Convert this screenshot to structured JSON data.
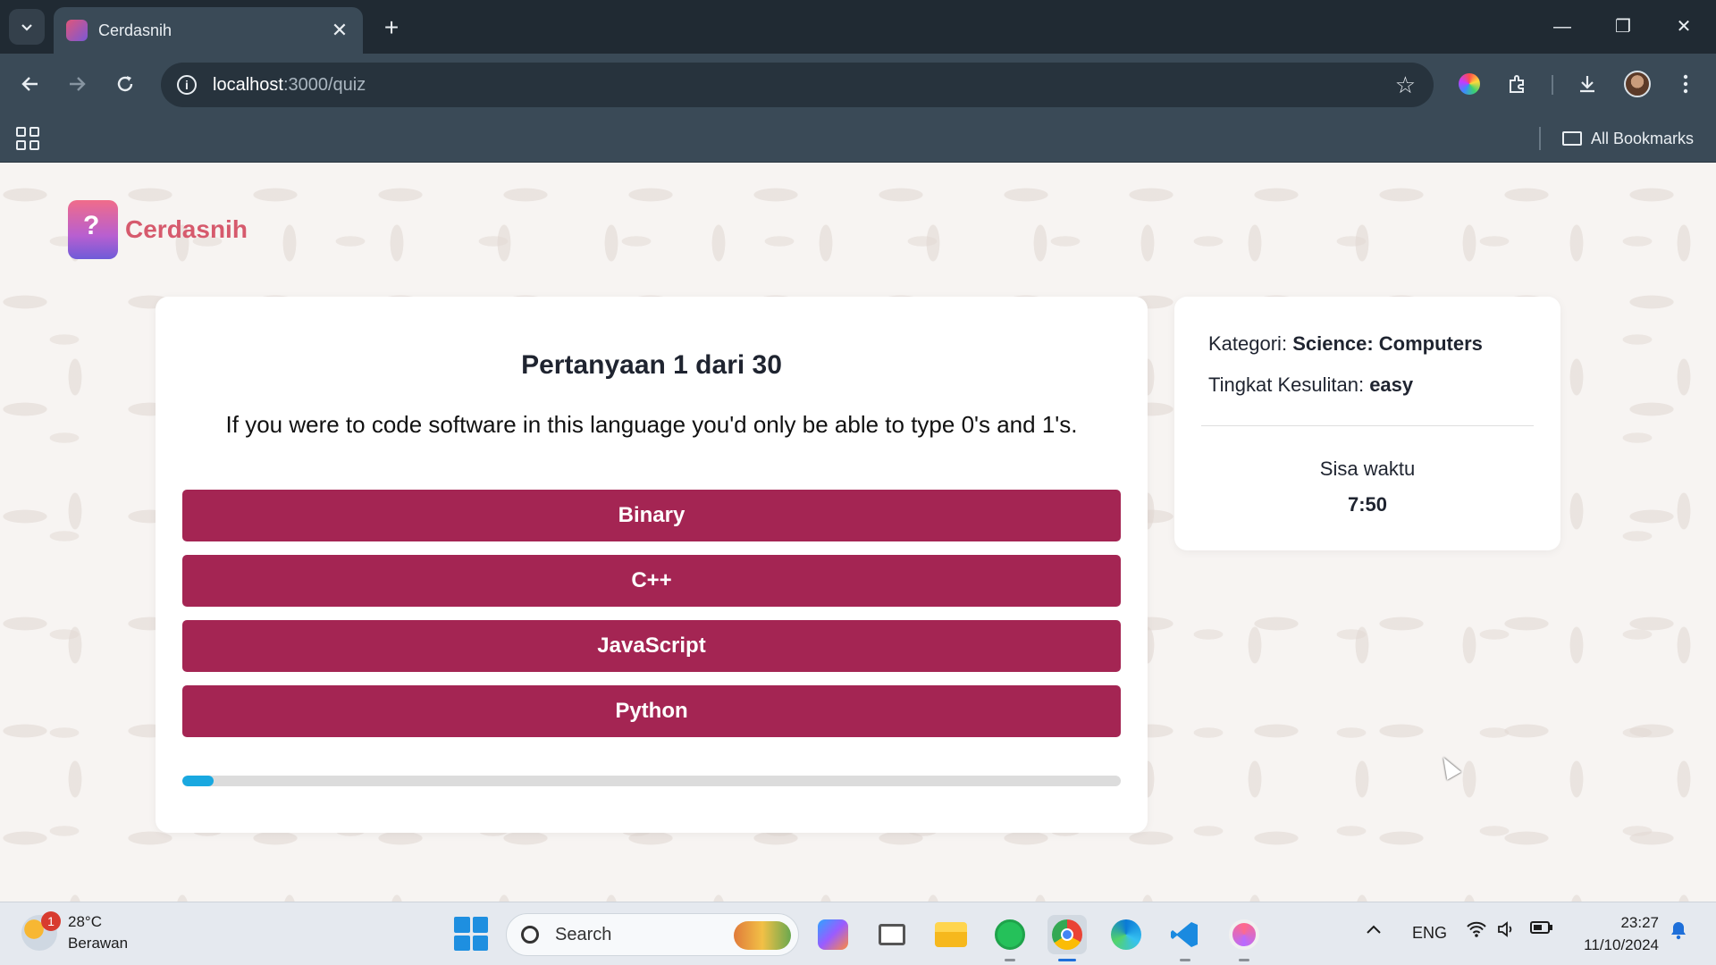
{
  "browser": {
    "tab_title": "Cerdasnih",
    "url_host": "localhost",
    "url_path": ":3000/quiz",
    "bookmarks_label": "All Bookmarks"
  },
  "app": {
    "logo_text": "Cerdasnih"
  },
  "quiz": {
    "title": "Pertanyaan 1 dari 30",
    "question": "If you were to code software in this language you'd only be able to type 0's and 1's.",
    "answers": [
      "Binary",
      "C++",
      "JavaScript",
      "Python"
    ],
    "progress_fraction": 0.033
  },
  "info": {
    "category_label": "Kategori:",
    "category_value": "Science: Computers",
    "difficulty_label": "Tingkat Kesulitan:",
    "difficulty_value": "easy",
    "timer_label": "Sisa waktu",
    "timer_value": "7:50"
  },
  "colors": {
    "answer_bg": "#a42553",
    "progress_fill": "#19a8e0",
    "logo_text": "#d65a6d"
  },
  "taskbar": {
    "weather_temp": "28°C",
    "weather_desc": "Berawan",
    "weather_badge": "1",
    "search_label": "Search",
    "language": "ENG",
    "time": "23:27",
    "date": "11/10/2024"
  }
}
